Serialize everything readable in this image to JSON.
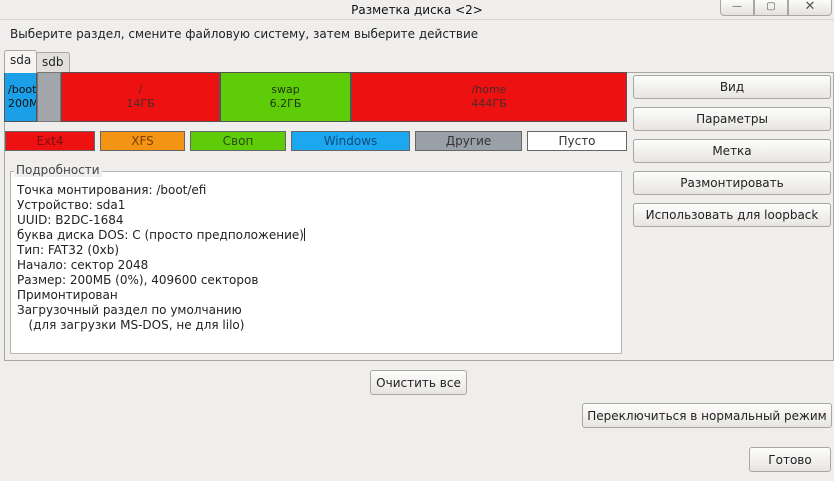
{
  "window": {
    "title": "Разметка диска <2>",
    "controls": {
      "minimize": "—",
      "maximize": "▢",
      "close": "✕"
    }
  },
  "instruction": "Выберите раздел, смените файловую систему, затем выберите действие",
  "tabs": [
    {
      "label": "sda",
      "selected": true
    },
    {
      "label": "sdb",
      "selected": false
    }
  ],
  "partitions": [
    {
      "name": "/boot",
      "size": "200M",
      "color": "#1b9fe6",
      "selected": true
    },
    {
      "name": "",
      "size": "",
      "color": "#a3a6ab"
    },
    {
      "name": "/",
      "size": "14ГБ",
      "color": "#ee1111"
    },
    {
      "name": "swap",
      "size": "6.2ГБ",
      "color": "#5fcc0a"
    },
    {
      "name": "/home",
      "size": "444ГБ",
      "color": "#ee1111"
    }
  ],
  "legend": [
    {
      "label": "Ext4",
      "color": "#ee1111"
    },
    {
      "label": "XFS",
      "color": "#f39415"
    },
    {
      "label": "Своп",
      "color": "#5fcc0a"
    },
    {
      "label": "Windows",
      "color": "#1ba8f0"
    },
    {
      "label": "Другие",
      "color": "#9aa0a7"
    },
    {
      "label": "Пусто",
      "color": "#ffffff"
    }
  ],
  "details": {
    "heading": "Подробности",
    "lines": [
      "Точка монтирования: /boot/efi",
      "Устройство: sda1",
      "UUID: B2DC-1684",
      "буква диска DOS: C (просто предположение)",
      "Тип: FAT32 (0xb)",
      "Начало: сектор 2048",
      "Размер: 200МБ (0%), 409600 секторов",
      "Примонтирован",
      "Загрузочный раздел по умолчанию",
      "   (для загрузки MS-DOS, не для lilo)"
    ]
  },
  "actions": {
    "view": "Вид",
    "params": "Параметры",
    "label": "Метка",
    "unmount": "Размонтировать",
    "loopback": "Использовать для loopback"
  },
  "clear_all": "Очистить все",
  "normal_mode": "Переключиться в нормальный режим",
  "done": "Готово"
}
